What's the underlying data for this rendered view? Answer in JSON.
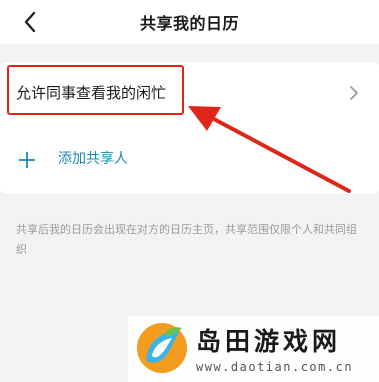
{
  "header": {
    "title": "共享我的日历",
    "back_icon": "chevron-left-icon"
  },
  "settings": {
    "allow_colleagues_label": "允许同事查看我的闲忙",
    "row_chevron_icon": "chevron-right-icon",
    "add_share_label": "添加共享人",
    "add_icon": "plus-icon"
  },
  "note": "共享后我的日历会出现在对方的日历主页，共享范围仅限个人和共同组织",
  "annotation": {
    "highlight_color": "#e0251b",
    "arrow_color": "#e0251b"
  },
  "watermark": {
    "title": "岛田游戏网",
    "url": "www.daotian.com.cn"
  },
  "colors": {
    "accent": "#1b8ab4",
    "background": "#f2f3f5"
  }
}
